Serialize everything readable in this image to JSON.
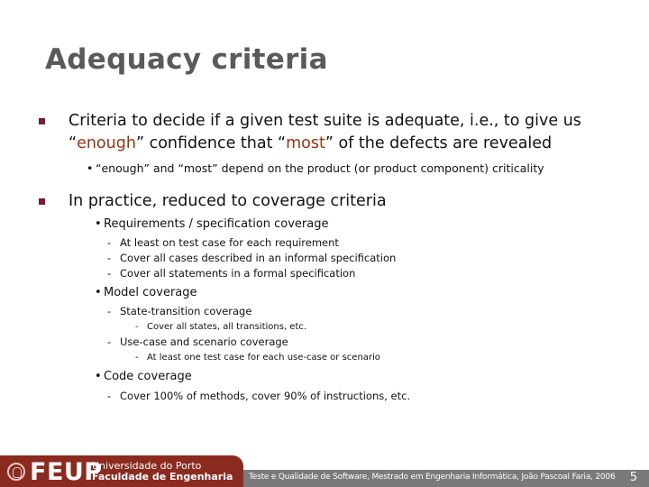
{
  "slide": {
    "title": "Adequacy criteria",
    "bullets": [
      {
        "line1": "Criteria to decide if a given test suite is adequate, i.e., to give us",
        "line2_parts": [
          "“",
          "enough",
          "” confidence that “",
          "most",
          "” of the defects are revealed"
        ],
        "sub": [
          {
            "text": "“enough” and “most” depend on the product (or product component) criticality"
          }
        ]
      },
      {
        "line1": "In practice, reduced to coverage criteria",
        "sub": [
          {
            "text": "Requirements / specification coverage",
            "items": [
              "At least on test case for each requirement",
              "Cover all cases described in an informal specification",
              "Cover all statements in a formal specification"
            ]
          },
          {
            "text": "Model coverage",
            "items": [
              {
                "text": "State-transition coverage",
                "items": [
                  "Cover all states, all transitions, etc."
                ]
              },
              {
                "text": "Use-case and scenario coverage",
                "items": [
                  "At least one test case for each use-case or scenario"
                ]
              }
            ]
          },
          {
            "text": "Code coverage",
            "items": [
              "Cover 100% of methods, cover 90% of instructions, etc."
            ]
          }
        ]
      }
    ]
  },
  "symbols": {
    "bullet": "•",
    "dash": "-"
  },
  "footer": {
    "logo_text": "FEUP",
    "university": "Universidade do Porto",
    "faculty": "Faculdade de Engenharia",
    "caption": "Teste e Qualidade de Software, Mestrado em Engenharia Informática, João Pascoal Faria, 2006",
    "page_number": "5"
  },
  "colors": {
    "title": "#5a5a5a",
    "accent": "#a0320e",
    "bullet_square": "#7b1b38",
    "brand": "#8b2a1f",
    "footer_bar": "#7a7a7a"
  }
}
